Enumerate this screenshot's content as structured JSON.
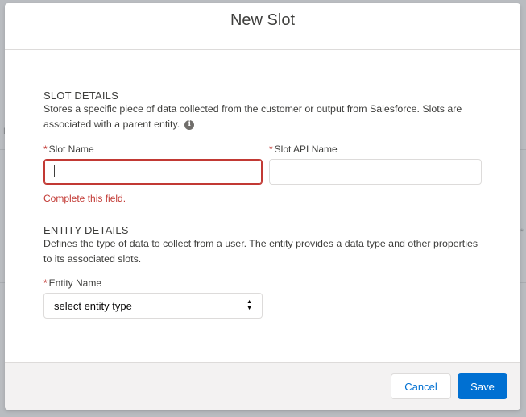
{
  "modal": {
    "title": "New Slot"
  },
  "slot_details": {
    "heading": "SLOT DETAILS",
    "description": "Stores a specific piece of data collected from the customer or output from Salesforce. Slots are associated with a parent entity.",
    "info_icon": "info-icon",
    "slot_name": {
      "required_mark": "*",
      "label": "Slot Name",
      "value": "",
      "error": "Complete this field."
    },
    "slot_api_name": {
      "required_mark": "*",
      "label": "Slot API Name",
      "value": ""
    }
  },
  "entity_details": {
    "heading": "ENTITY DETAILS",
    "description": "Defines the type of data to collect from a user. The entity provides a data type and other properties to its associated slots.",
    "entity_name": {
      "required_mark": "*",
      "label": "Entity Name",
      "selected": "select entity type"
    }
  },
  "footer": {
    "cancel_label": "Cancel",
    "save_label": "Save"
  },
  "colors": {
    "brand": "#0070d2",
    "error": "#c23934",
    "overlay": "#b9bcc0"
  }
}
